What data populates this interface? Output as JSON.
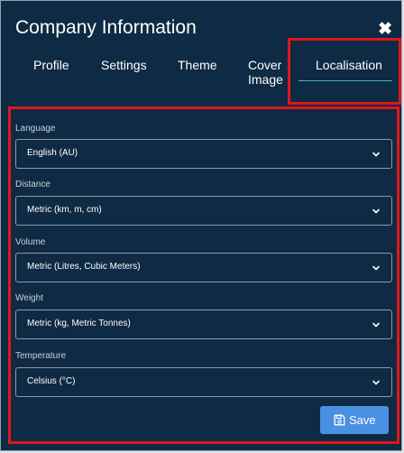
{
  "dialog": {
    "title": "Company Information",
    "close_glyph": "✖"
  },
  "tabs": [
    {
      "label": "Profile"
    },
    {
      "label": "Settings"
    },
    {
      "label": "Theme"
    },
    {
      "label_line1": "Cover",
      "label_line2": "Image"
    },
    {
      "label": "Localisation",
      "active": true
    }
  ],
  "fields": {
    "language": {
      "label": "Language",
      "value": "English (AU)"
    },
    "distance": {
      "label": "Distance",
      "value": "Metric (km, m, cm)"
    },
    "volume": {
      "label": "Volume",
      "value": "Metric (Litres, Cubic Meters)"
    },
    "weight": {
      "label": "Weight",
      "value": "Metric (kg, Metric Tonnes)"
    },
    "temperature": {
      "label": "Temperature",
      "value": "Celsius (°C)"
    }
  },
  "actions": {
    "save_label": "Save"
  },
  "colors": {
    "background": "#0f2a44",
    "accent_underline": "#3fb3c9",
    "save_button": "#4a90e2",
    "highlight_border": "#e0161c"
  },
  "icons": {
    "close": "close-icon",
    "chevron": "chevron-down-icon",
    "save": "floppy-disk-icon"
  }
}
